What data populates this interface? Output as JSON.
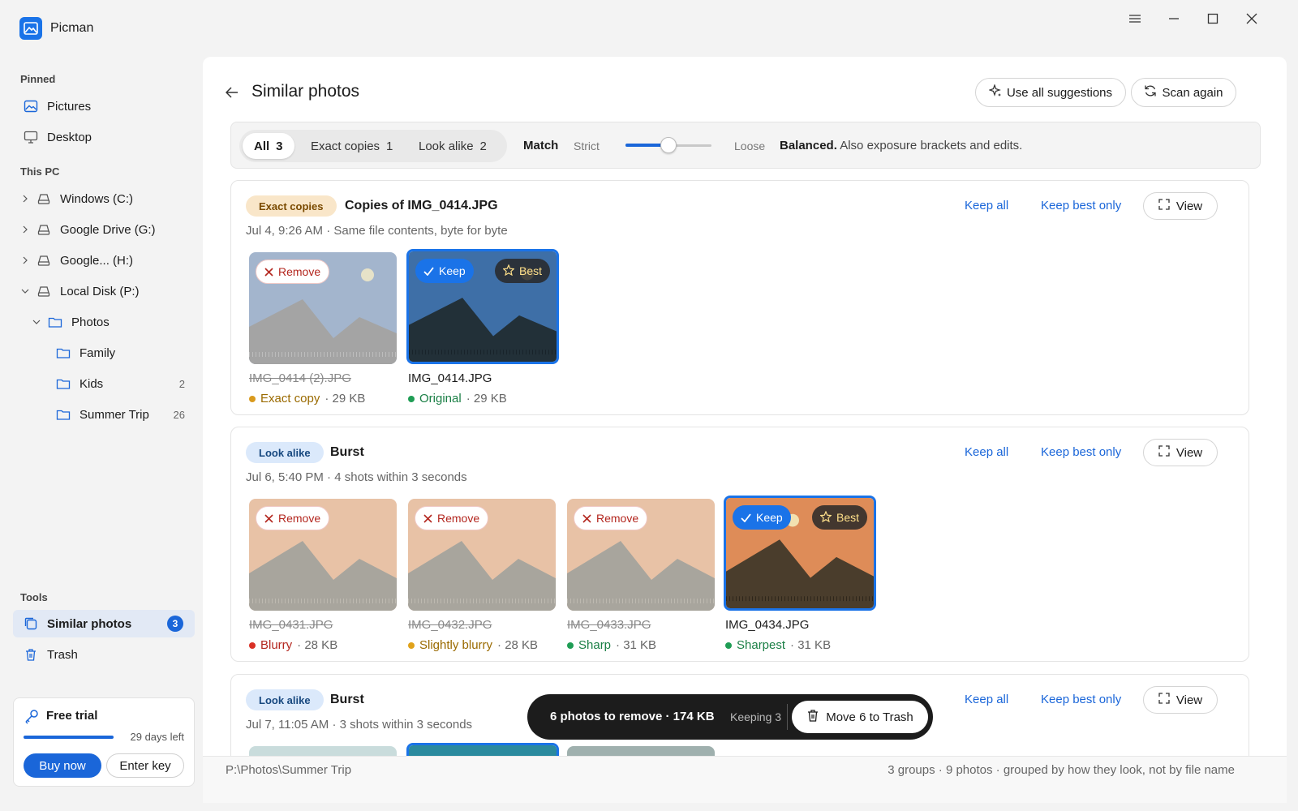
{
  "app": {
    "title": "Picman"
  },
  "sidebar": {
    "pinned_label": "Pinned",
    "pinned": [
      {
        "label": "Pictures",
        "icon": "image-icon"
      },
      {
        "label": "Desktop",
        "icon": "monitor-icon"
      }
    ],
    "thispc_label": "This PC",
    "drives": [
      {
        "label": "Windows (C:)",
        "expanded": false
      },
      {
        "label": "Google Drive (G:)",
        "expanded": false
      },
      {
        "label": "Google... (H:)",
        "expanded": false
      },
      {
        "label": "Local Disk (P:)",
        "expanded": true
      }
    ],
    "folders": [
      {
        "label": "Photos",
        "count": ""
      },
      {
        "label": "Family",
        "count": ""
      },
      {
        "label": "Kids",
        "count": "2"
      },
      {
        "label": "Summer Trip",
        "count": "26"
      }
    ],
    "tools_label": "Tools",
    "tools": [
      {
        "label": "Similar photos",
        "badge": "3",
        "active": true
      },
      {
        "label": "Trash",
        "badge": "",
        "active": false
      }
    ],
    "trial": {
      "title": "Free trial",
      "days_left": "29 days left",
      "progress": 0.97,
      "buy_label": "Buy now",
      "key_label": "Enter key"
    }
  },
  "header": {
    "title": "Similar photos",
    "use_all_label": "Use all suggestions",
    "scan_again_label": "Scan again"
  },
  "filter": {
    "tabs": [
      {
        "label": "All",
        "count": "3",
        "active": true
      },
      {
        "label": "Exact copies",
        "count": "1",
        "active": false
      },
      {
        "label": "Look alike",
        "count": "2",
        "active": false
      }
    ],
    "match_label": "Match",
    "strict_label": "Strict",
    "loose_label": "Loose",
    "slider_value": 0.5,
    "mode_name": "Balanced.",
    "mode_desc": "Also exposure brackets and edits."
  },
  "group_actions": {
    "keep_all": "Keep all",
    "keep_best": "Keep best only",
    "view": "View"
  },
  "chips": {
    "remove": "Remove",
    "keep": "Keep",
    "best": "Best"
  },
  "groups": [
    {
      "tag": "Exact copies",
      "title": "Copies of IMG_0414.JPG",
      "subtitle": "Jul 4, 9:26 AM · Same file contents, byte for byte",
      "photos": [
        {
          "name": "IMG_0414 (2).JPG",
          "status": "Exact copy",
          "size": "· 29 KB",
          "keep": false,
          "best": false
        },
        {
          "name": "IMG_0414.JPG",
          "status": "Original",
          "size": "· 29 KB",
          "keep": true,
          "best": true
        }
      ]
    },
    {
      "tag": "Look alike",
      "title": "Burst",
      "subtitle": "Jul 6, 5:40 PM · 4 shots within 3 seconds",
      "photos": [
        {
          "name": "IMG_0431.JPG",
          "status": "Blurry",
          "size": "· 28 KB",
          "keep": false,
          "best": false
        },
        {
          "name": "IMG_0432.JPG",
          "status": "Slightly blurry",
          "size": "· 28 KB",
          "keep": false,
          "best": false
        },
        {
          "name": "IMG_0433.JPG",
          "status": "Sharp",
          "size": "· 31 KB",
          "keep": false,
          "best": false
        },
        {
          "name": "IMG_0434.JPG",
          "status": "Sharpest",
          "size": "· 31 KB",
          "keep": true,
          "best": true
        }
      ]
    },
    {
      "tag": "Look alike",
      "title": "Burst",
      "subtitle": "Jul 7, 11:05 AM · 3 shots within 3 seconds"
    }
  ],
  "actionbar": {
    "summary": "6 photos to remove · 174 KB",
    "keeping": "Keeping 3",
    "move_label": "Move 6 to Trash"
  },
  "statusbar": {
    "path": "P:\\Photos\\Summer Trip",
    "summary": "3 groups · 9 photos · grouped by how they look, not by file name"
  },
  "colors": {
    "accent": "#1a66d9",
    "keep_border": "#1a73e8",
    "status_exact": "#d99a1e",
    "status_original": "#1f9d55",
    "status_blurry": "#d93025",
    "status_slight": "#e0a21b",
    "status_sharp": "#1f9d55"
  }
}
